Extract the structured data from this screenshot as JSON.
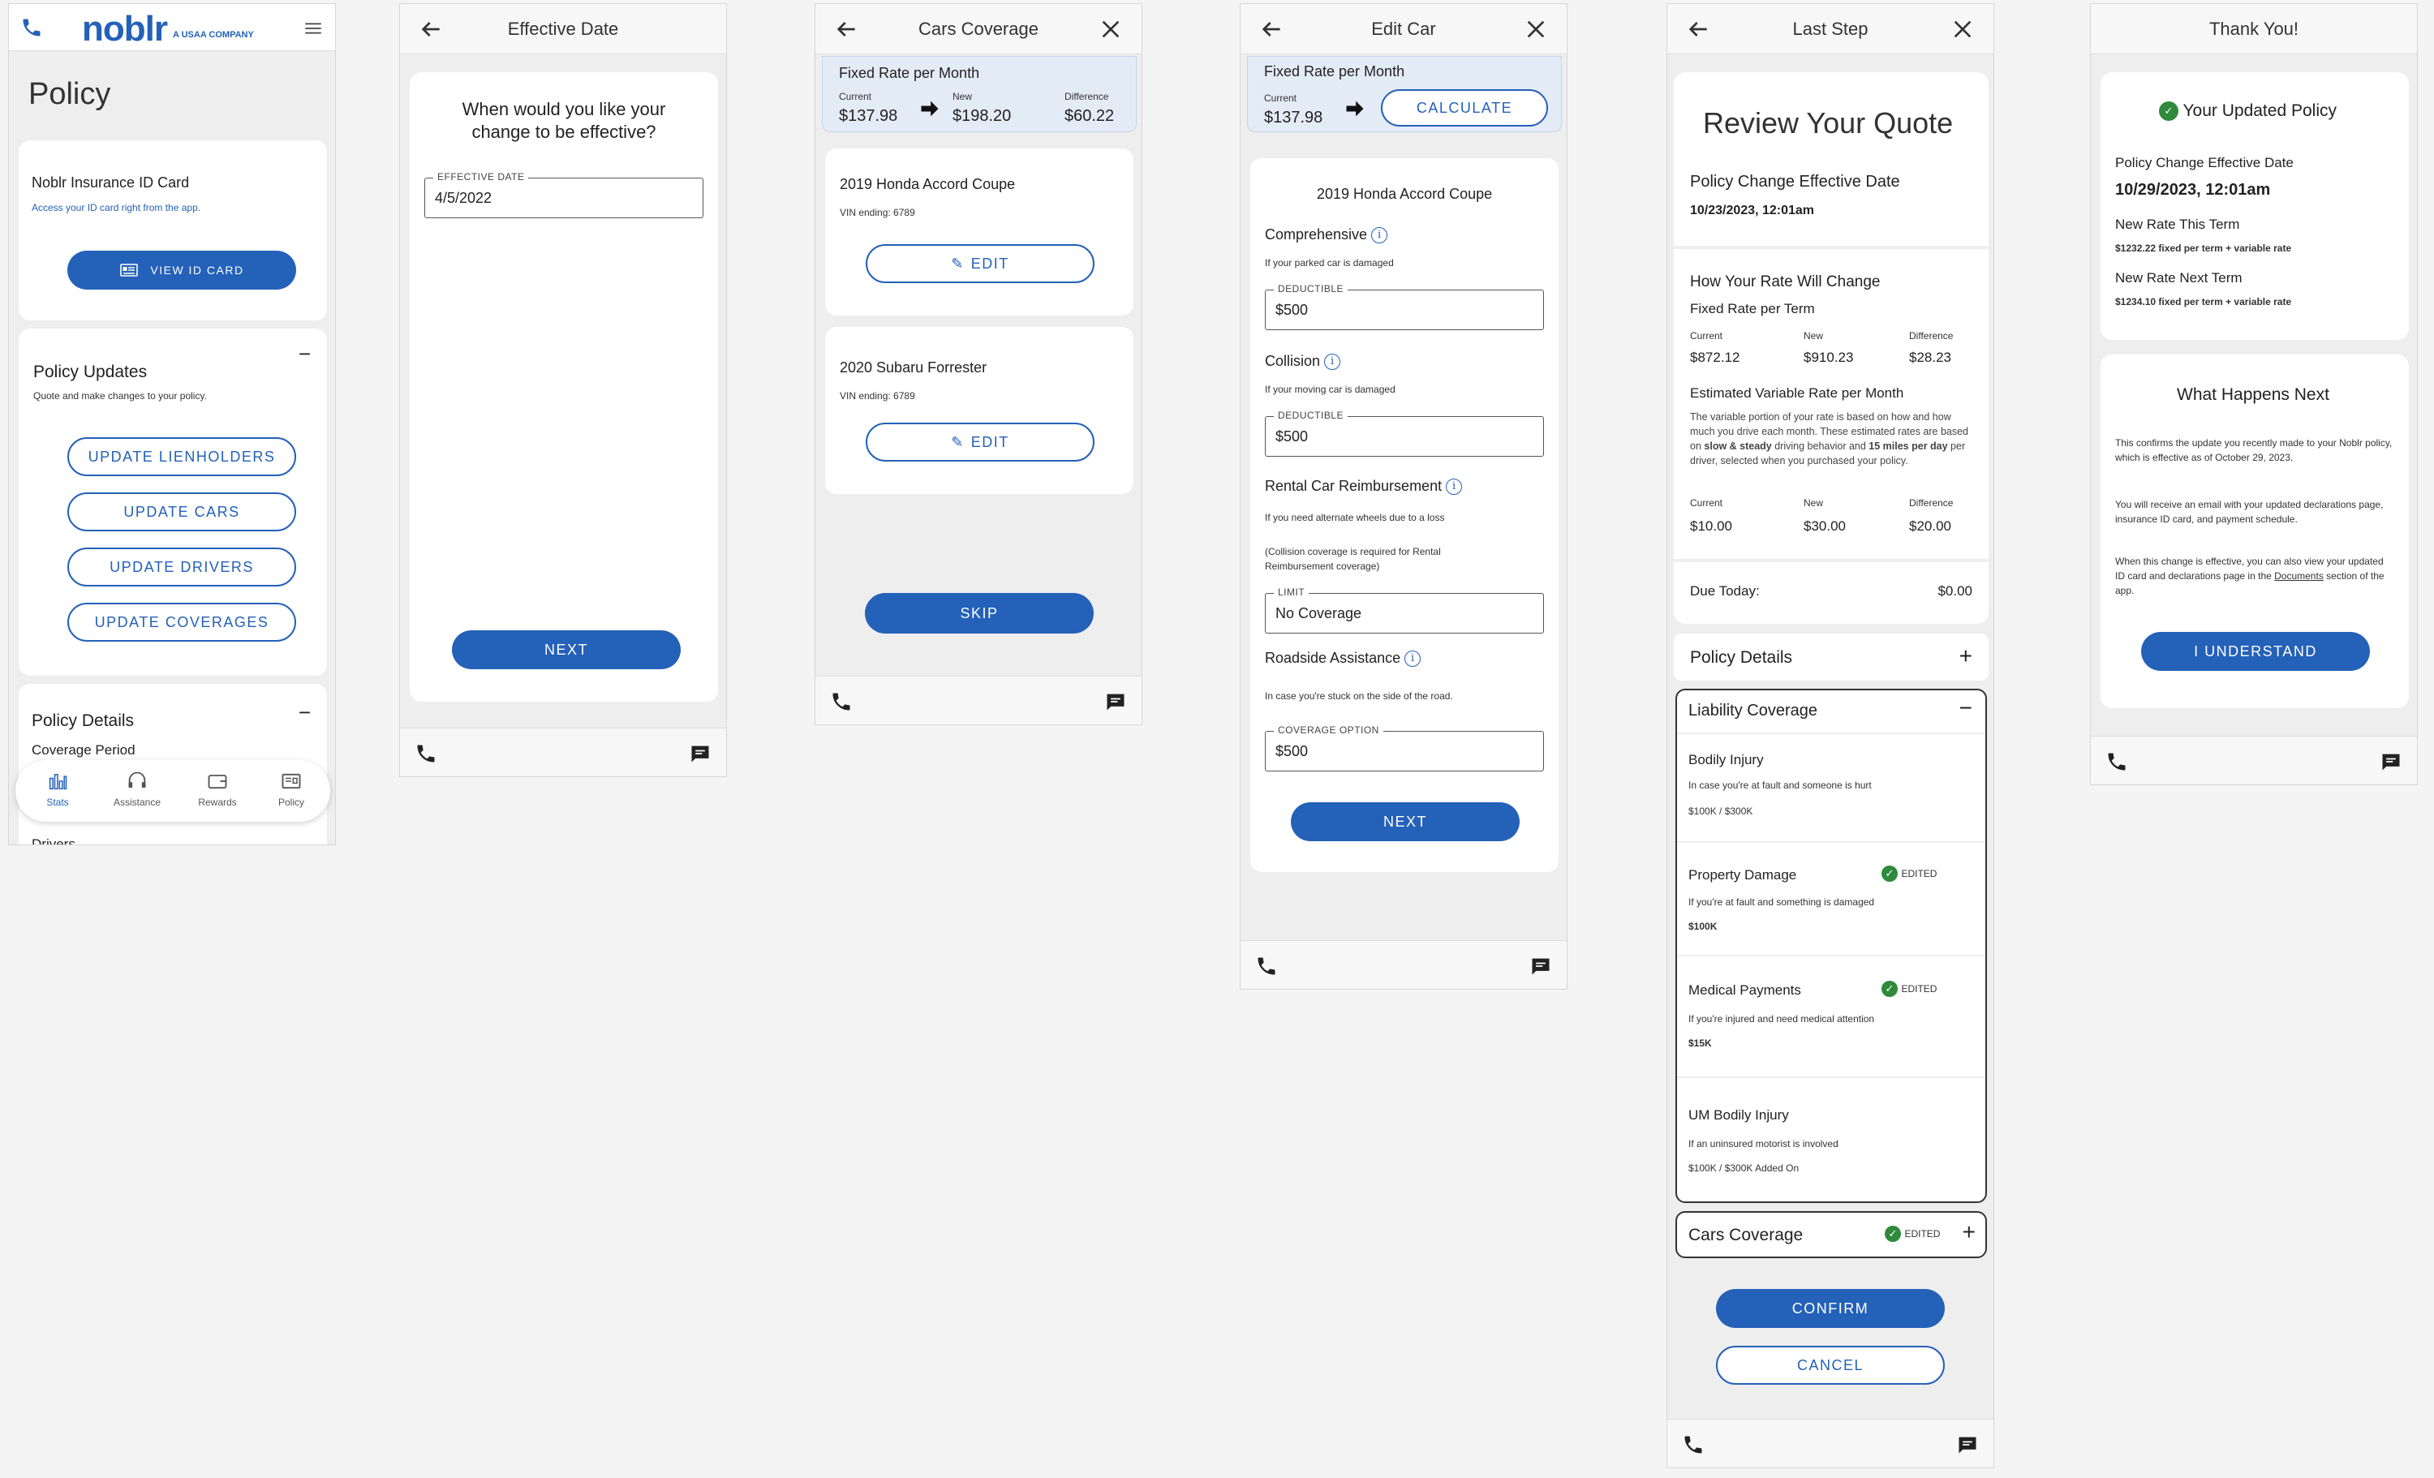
{
  "policy_screen": {
    "logo": "noblr",
    "logo_sub": "A USAA COMPANY",
    "title": "Policy",
    "id_card": {
      "title": "Noblr Insurance ID Card",
      "subtitle": "Access your ID card right from the app.",
      "button": "VIEW ID CARD"
    },
    "updates": {
      "title": "Policy Updates",
      "subtitle": "Quote and make changes to your policy.",
      "buttons": [
        "UPDATE LIENHOLDERS",
        "UPDATE CARS",
        "UPDATE DRIVERS",
        "UPDATE COVERAGES"
      ]
    },
    "details": {
      "title": "Policy Details",
      "item1": "Coverage Period",
      "item2": "Drivers"
    },
    "nav": [
      "Stats",
      "Assistance",
      "Rewards",
      "Policy"
    ]
  },
  "effective_screen": {
    "title": "Effective Date",
    "question": "When would you like your change to be effective?",
    "field_label": "EFFECTIVE DATE",
    "field_value": "4/5/2022",
    "next": "NEXT"
  },
  "cars_screen": {
    "title": "Cars Coverage",
    "rate": {
      "label": "Fixed Rate per Month",
      "current_label": "Current",
      "current": "$137.98",
      "new_label": "New",
      "new": "$198.20",
      "diff_label": "Difference",
      "diff": "$60.22"
    },
    "cars": [
      {
        "name": "2019 Honda Accord Coupe",
        "vin": "VIN ending: 6789",
        "edit": "EDIT"
      },
      {
        "name": "2020 Subaru Forrester",
        "vin": "VIN ending: 6789",
        "edit": "EDIT"
      }
    ],
    "skip": "SKIP"
  },
  "edit_screen": {
    "title": "Edit Car",
    "rate": {
      "label": "Fixed Rate per Month",
      "current_label": "Current",
      "current": "$137.98",
      "calculate": "CALCULATE"
    },
    "car": "2019 Honda Accord Coupe",
    "comprehensive": {
      "title": "Comprehensive",
      "desc": "If your parked car is damaged",
      "label": "DEDUCTIBLE",
      "value": "$500"
    },
    "collision": {
      "title": "Collision",
      "desc": "If your moving car is damaged",
      "label": "DEDUCTIBLE",
      "value": "$500"
    },
    "rental": {
      "title": "Rental Car Reimbursement",
      "desc": "If you need alternate wheels due to a loss",
      "note": "(Collision coverage is required for Rental Reimbursement coverage)",
      "label": "LIMIT",
      "value": "No Coverage"
    },
    "roadside": {
      "title": "Roadside Assistance",
      "desc": "In case you're stuck on the side of the road.",
      "label": "COVERAGE OPTION",
      "value": "$500"
    },
    "next": "NEXT"
  },
  "last_screen": {
    "title": "Last Step",
    "review_title": "Review Your Quote",
    "eff_label": "Policy Change Effective Date",
    "eff_value": "10/23/2023, 12:01am",
    "rate_title": "How Your Rate Will Change",
    "fixed_title": "Fixed Rate per Term",
    "col_current": "Current",
    "col_new": "New",
    "col_diff": "Difference",
    "fixed_current": "$872.12",
    "fixed_new": "$910.23",
    "fixed_diff": "$28.23",
    "var_title": "Estimated Variable Rate per Month",
    "var_desc_1": "The variable portion of your rate is based on how and how much you drive each month. These estimated rates are based on ",
    "var_desc_bold1": "slow & steady",
    "var_desc_2": " driving behavior and ",
    "var_desc_bold2": "15 miles per day",
    "var_desc_3": " per driver, selected when you purchased your policy.",
    "var_current": "$10.00",
    "var_new": "$30.00",
    "var_diff": "$20.00",
    "due_label": "Due Today:",
    "due_value": "$0.00",
    "details_title": "Policy Details",
    "liability_title": "Liability Coverage",
    "edited": "EDITED",
    "bodily": {
      "title": "Bodily Injury",
      "desc": "In case you're at fault and someone is hurt",
      "value": "$100K / $300K"
    },
    "property": {
      "title": "Property Damage",
      "desc": "If you're at fault and something is damaged",
      "value": "$100K"
    },
    "medical": {
      "title": "Medical Payments",
      "desc": "If you're injured and need medical attention",
      "value": "$15K"
    },
    "um": {
      "title": "UM Bodily Injury",
      "desc": "If an uninsured motorist is involved",
      "value": "$100K / $300K Added On"
    },
    "cars_title": "Cars Coverage",
    "confirm": "CONFIRM",
    "cancel": "CANCEL"
  },
  "thanks_screen": {
    "title": "Thank You!",
    "updated_title": "Your Updated Policy",
    "eff_label": "Policy Change Effective Date",
    "eff_value": "10/29/2023, 12:01am",
    "this_term_label": "New Rate This Term",
    "this_term_value": "$1232.22 fixed per term + variable rate",
    "next_term_label": "New Rate Next Term",
    "next_term_value": "$1234.10 fixed per term + variable rate",
    "next_title": "What Happens Next",
    "p1": "This confirms the update you recently made to your Noblr policy, which is effective as of October 29, 2023.",
    "p2": "You will receive an email with your updated declarations page, insurance ID card, and payment schedule.",
    "p3a": "When this change is effective, you can also view your updated ID card and declarations page in the ",
    "p3link": "Documents",
    "p3b": " section of the app.",
    "understand": "I UNDERSTAND"
  },
  "colors": {
    "primary": "#2461b8",
    "success": "#2f8a3b",
    "rate_box": "#e3ebf6"
  }
}
